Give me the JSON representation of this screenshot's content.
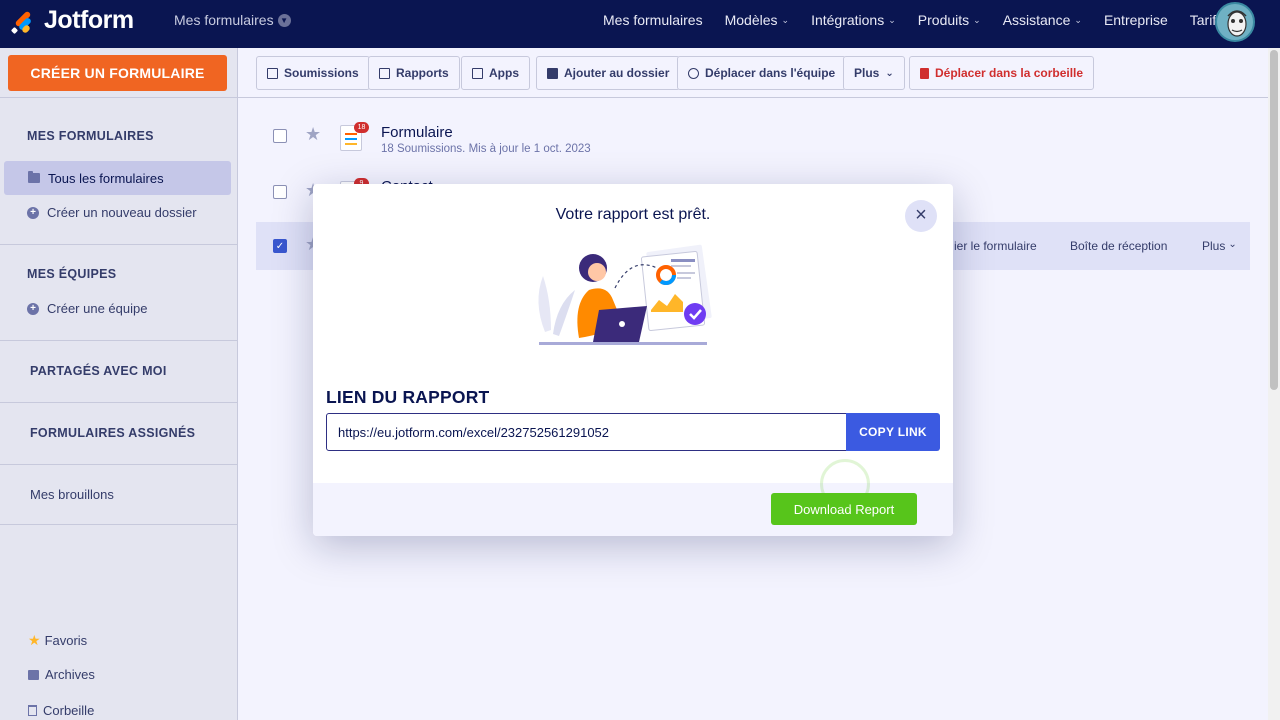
{
  "topbar": {
    "brand": "Jotform",
    "breadcrumb": "Mes formulaires",
    "nav": [
      {
        "label": "Mes formulaires",
        "dropdown": false
      },
      {
        "label": "Modèles",
        "dropdown": true
      },
      {
        "label": "Intégrations",
        "dropdown": true
      },
      {
        "label": "Produits",
        "dropdown": true
      },
      {
        "label": "Assistance",
        "dropdown": true
      },
      {
        "label": "Entreprise",
        "dropdown": false
      },
      {
        "label": "Tarifs",
        "dropdown": false
      }
    ]
  },
  "sidebar": {
    "create_button": "CRÉER UN FORMULAIRE",
    "my_forms_heading": "MES FORMULAIRES",
    "all_forms": "Tous les formulaires",
    "new_folder": "Créer un nouveau dossier",
    "my_teams_heading": "MES ÉQUIPES",
    "create_team": "Créer une équipe",
    "shared_heading": "PARTAGÉS AVEC MOI",
    "assigned_heading": "FORMULAIRES ASSIGNÉS",
    "drafts": "Mes brouillons",
    "favorites": "Favoris",
    "archives": "Archives",
    "trash": "Corbeille"
  },
  "toolbar": {
    "submissions": "Soumissions",
    "reports": "Rapports",
    "apps": "Apps",
    "add_folder": "Ajouter au dossier",
    "move_team": "Déplacer dans l'équipe",
    "more": "Plus",
    "trash": "Déplacer dans la corbeille"
  },
  "forms": [
    {
      "title": "Formulaire",
      "meta": "18 Soumissions. Mis à jour le 1 oct. 2023",
      "badge": "18"
    },
    {
      "title": "Contact",
      "meta": "",
      "badge": "9"
    }
  ],
  "row_actions": {
    "edit": "ier le formulaire",
    "inbox": "Boîte de réception",
    "more": "Plus"
  },
  "modal": {
    "title": "Votre rapport est prêt.",
    "section_label": "LIEN DU RAPPORT",
    "link_value": "https://eu.jotform.com/excel/232752561291052",
    "copy_button": "COPY LINK",
    "download_button": "Download Report"
  },
  "colors": {
    "navbar": "#0a1551",
    "create_button": "#f06522",
    "copy_button": "#3b5ae1",
    "download_button": "#57c51b",
    "danger": "#d02e2e"
  }
}
